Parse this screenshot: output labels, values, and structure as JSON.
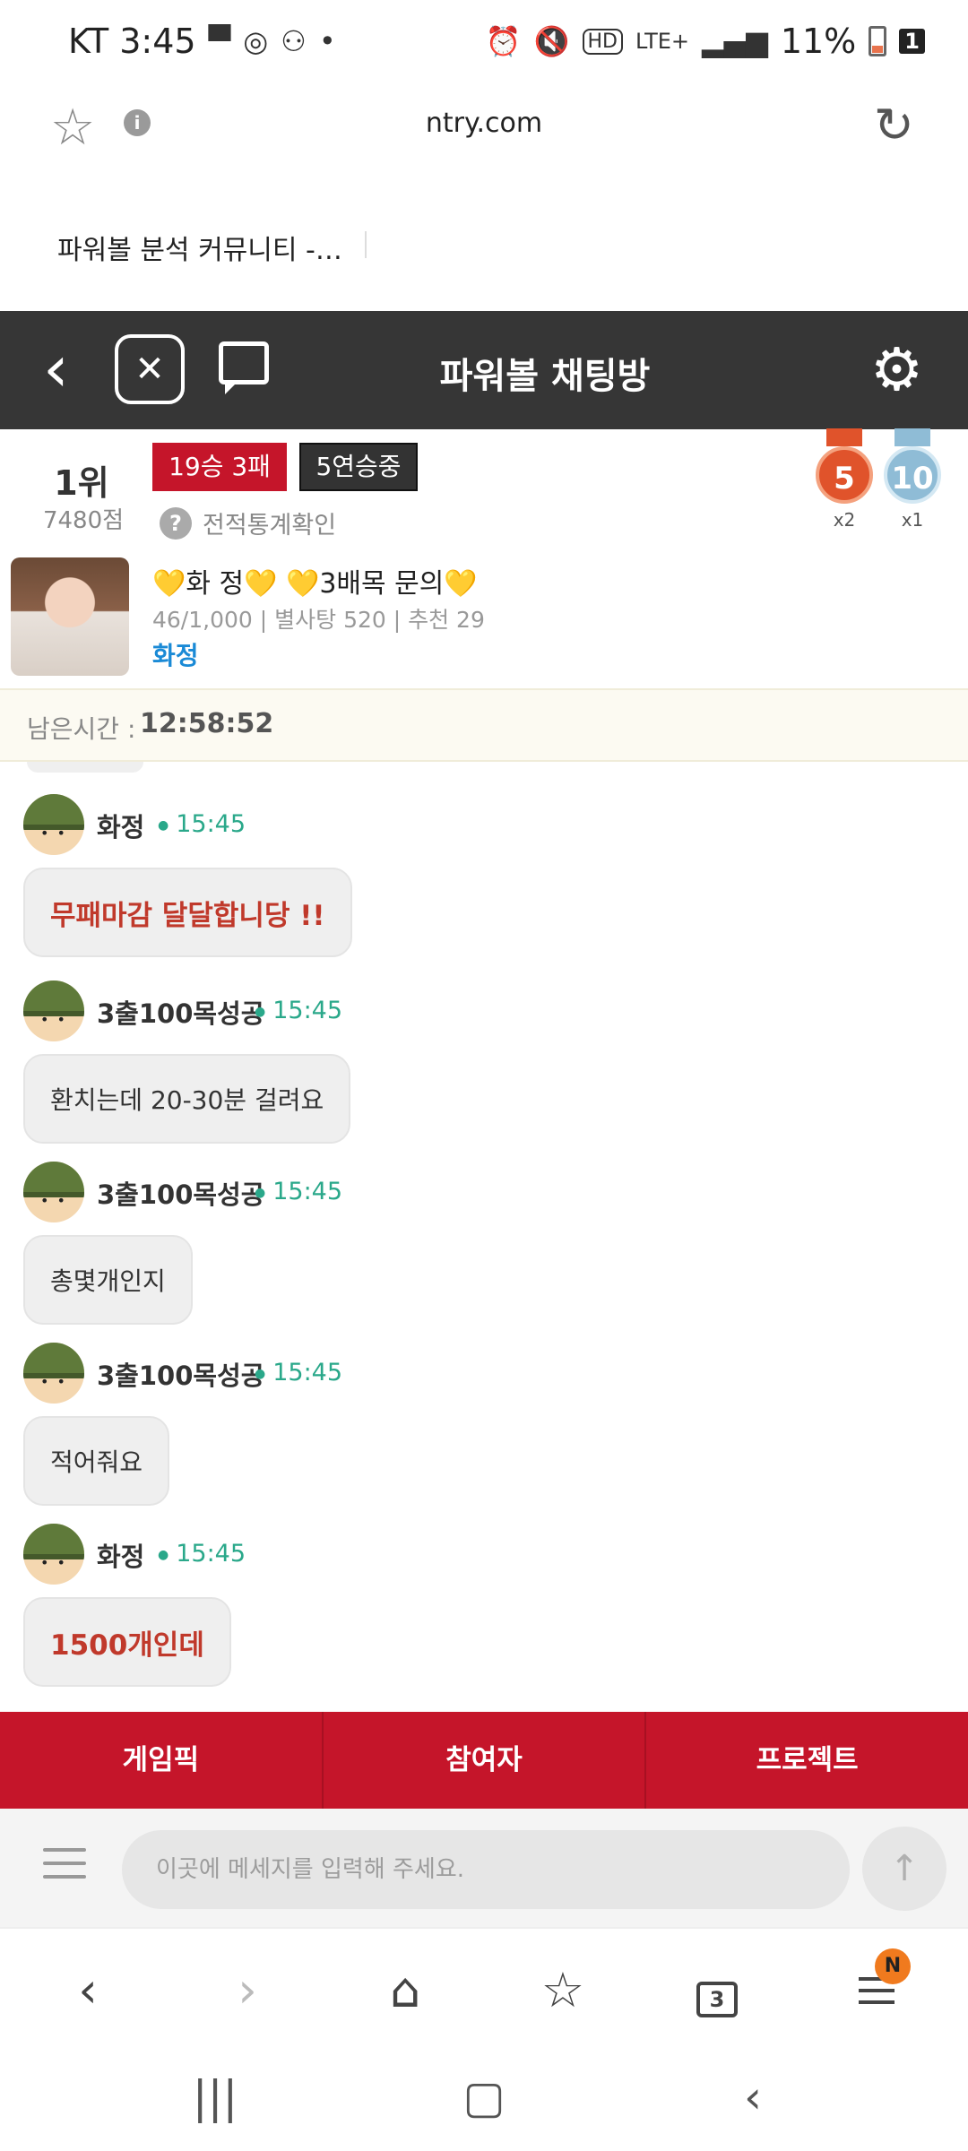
{
  "status_bar": {
    "carrier_time": "KT 3:45",
    "network": "LTE+",
    "battery_pct": "11%",
    "sim_badge": "1"
  },
  "browser": {
    "url": "ntry.com",
    "page_title": "파워볼 분석 커뮤니티 -…",
    "tab_count": "3",
    "notification_badge": "N"
  },
  "header": {
    "title": "파워볼 채팅방"
  },
  "ranking": {
    "rank": "1위",
    "points": "7480점",
    "record_badge": "19승 3패",
    "streak_badge": "5연승중",
    "stats_link": "전적통계확인",
    "medals": [
      {
        "value": "5",
        "count": "x2",
        "color": "#e0532b"
      },
      {
        "value": "10",
        "count": "x1",
        "color": "#8fbcd6"
      }
    ]
  },
  "profile": {
    "title": "💛화 정💛 💛3배목 문의💛",
    "meta": "46/1,000 | 별사탕 520 | 추천 29",
    "name": "화정"
  },
  "timer": {
    "label": "남은시간 :",
    "value": "12:58:52"
  },
  "messages": [
    {
      "user": "화정",
      "time": "15:45",
      "text": "무패마감 달달합니당 !!",
      "highlight": true
    },
    {
      "user": "3출100목성공",
      "time": "15:45",
      "text": "환치는데 20-30분 걸려요",
      "highlight": false
    },
    {
      "user": "3출100목성공",
      "time": "15:45",
      "text": "총몇개인지",
      "highlight": false
    },
    {
      "user": "3출100목성공",
      "time": "15:45",
      "text": "적어줘요",
      "highlight": false
    },
    {
      "user": "화정",
      "time": "15:45",
      "text": "1500개인데",
      "highlight": true
    }
  ],
  "bottom_tabs": [
    "게임픽",
    "참여자",
    "프로젝트"
  ],
  "input": {
    "placeholder": "이곳에 메세지를 입력해 주세요."
  },
  "colors": {
    "header_bg": "#363636",
    "accent_red": "#c5152a",
    "time_green": "#2aa88a",
    "name_blue": "#1a8ad6"
  },
  "icons": {
    "star": "star-icon",
    "info": "info-icon",
    "reload": "reload-icon",
    "back": "back-arrow-icon",
    "logo": "powerball-logo-icon",
    "chat": "chat-bubble-icon",
    "settings": "gear-icon"
  }
}
